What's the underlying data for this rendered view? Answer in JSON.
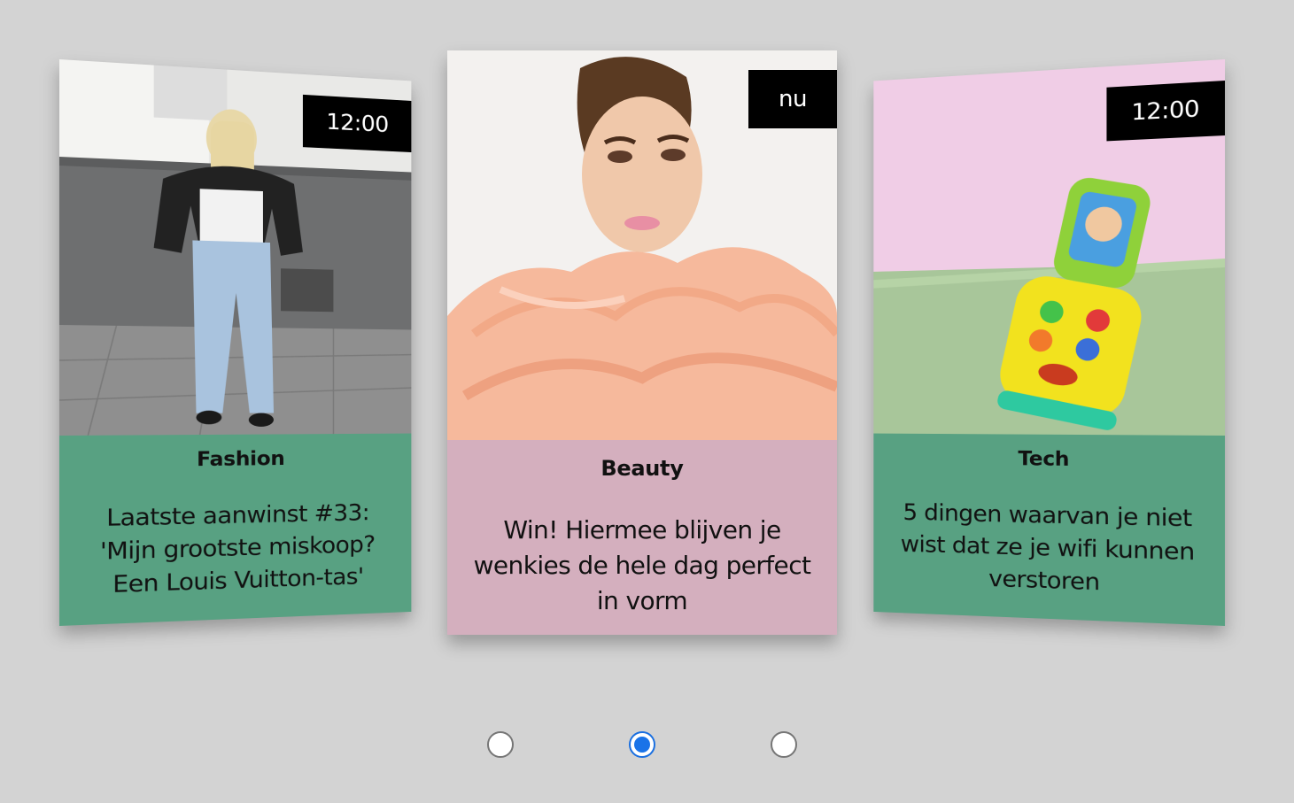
{
  "colors": {
    "background": "#d3d3d3",
    "green_card": "#58a182",
    "pink_card": "#d4afbe",
    "badge": "#000000",
    "radio_selected": "#1a73e8"
  },
  "cards": [
    {
      "time": "12:00",
      "category": "Fashion",
      "headline": "Laatste aanwinst #33: 'Mijn grootste miskoop? Een Louis Vuitton-tas'",
      "color": "#58a182",
      "image": "woman-in-jacket-street-photo"
    },
    {
      "time": "nu",
      "category": "Beauty",
      "headline": "Win! Hiermee blijven je wenkies de hele dag perfect in vorm",
      "color": "#d4afbe",
      "image": "model-peach-tulle-photo"
    },
    {
      "time": "12:00",
      "category": "Tech",
      "headline": "5 dingen waarvan je niet wist dat ze je wifi kunnen verstoren",
      "color": "#58a182",
      "image": "toy-flip-phone-photo"
    }
  ],
  "pagination": {
    "options": [
      "slide-1",
      "slide-2",
      "slide-3"
    ],
    "selected_index": 1
  }
}
